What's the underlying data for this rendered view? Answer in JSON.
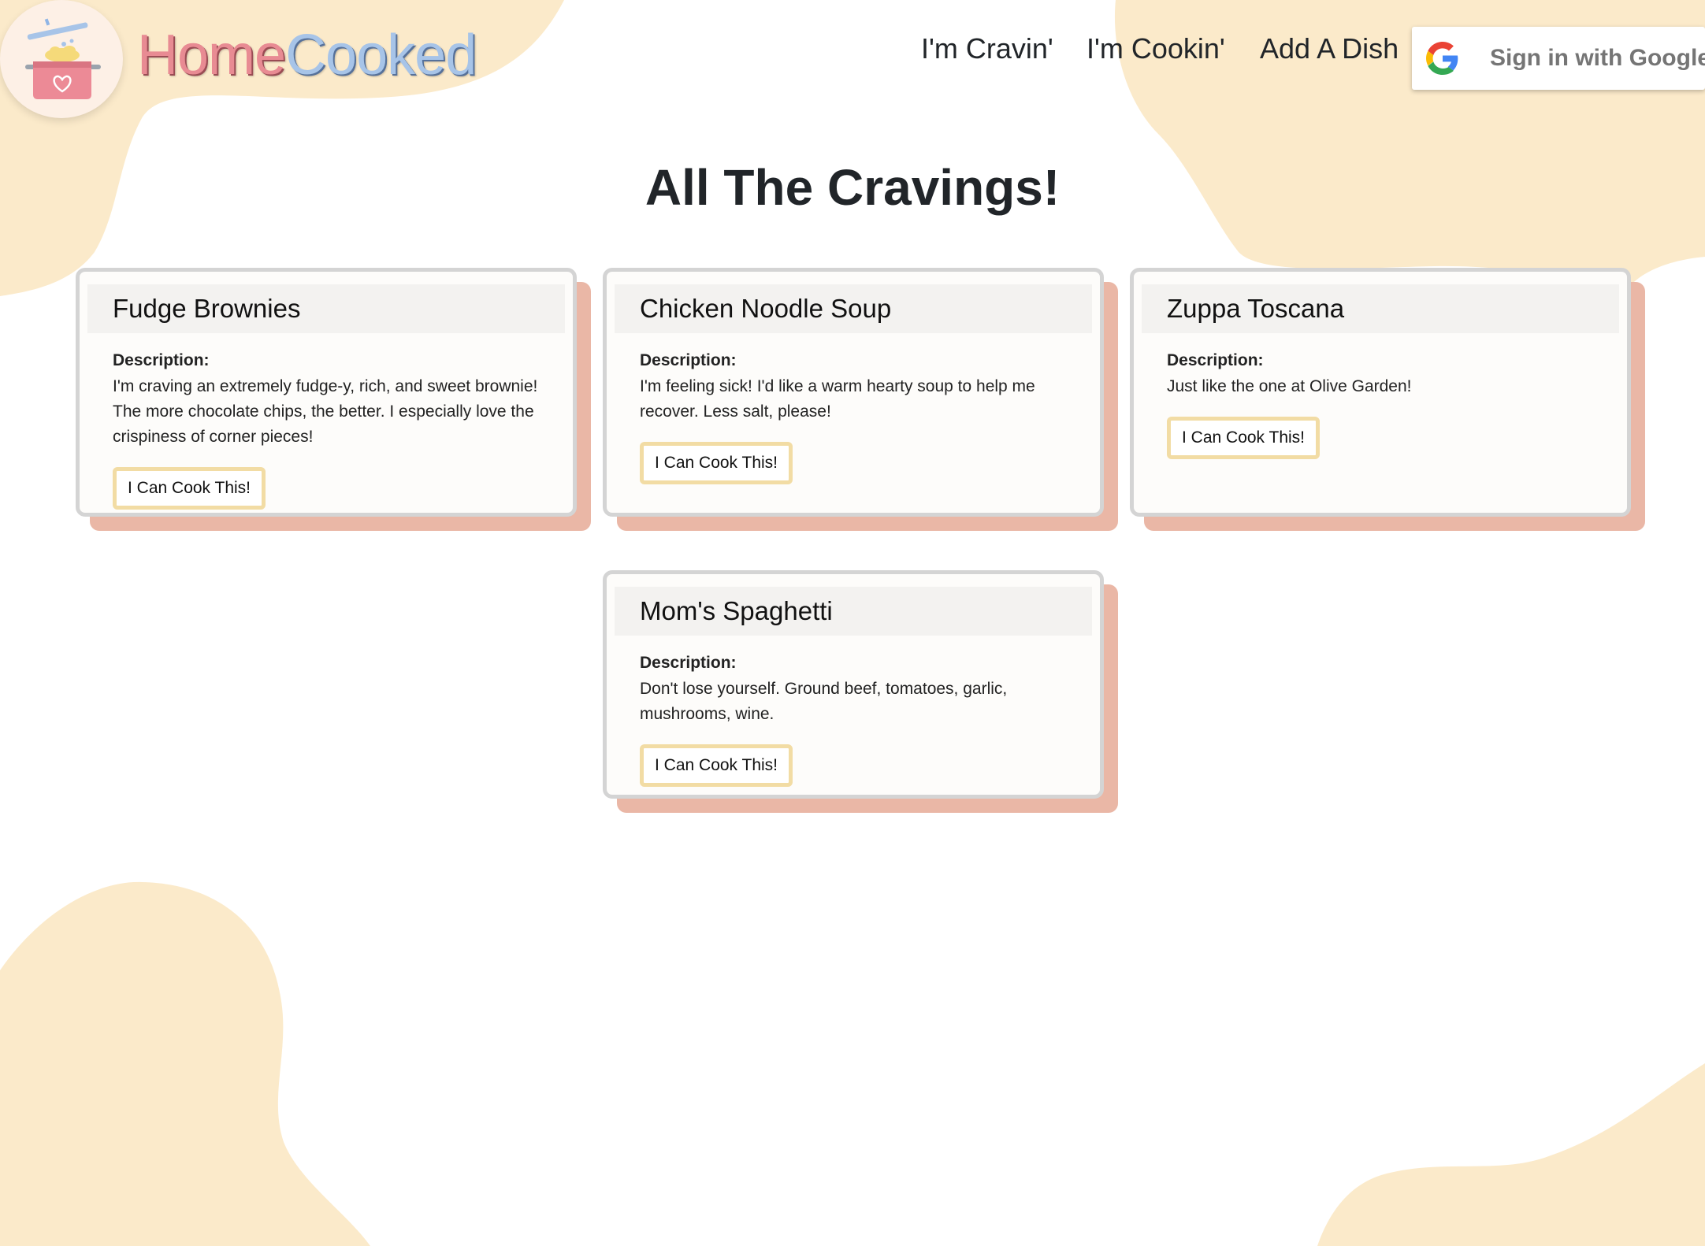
{
  "app": {
    "brand_home": "Home",
    "brand_cooked": "Cooked"
  },
  "nav": {
    "links": [
      {
        "label": "I'm Cravin'"
      },
      {
        "label": "I'm Cookin'"
      },
      {
        "label": "Add A Dish"
      }
    ],
    "google_signin_label": "Sign in with Google"
  },
  "main": {
    "title": "All The Cravings!",
    "cards": [
      {
        "title": "Fudge Brownies",
        "description_label": "Description:",
        "description": "I'm craving an extremely fudge-y, rich, and sweet brownie! The more chocolate chips, the better. I especially love the crispiness of corner pieces!",
        "button_label": "I Can Cook This!"
      },
      {
        "title": "Chicken Noodle Soup",
        "description_label": "Description:",
        "description": "I'm feeling sick! I'd like a warm hearty soup to help me recover. Less salt, please!",
        "button_label": "I Can Cook This!"
      },
      {
        "title": "Zuppa Toscana",
        "description_label": "Description:",
        "description": "Just like the one at Olive Garden!",
        "button_label": "I Can Cook This!"
      },
      {
        "title": "Mom's Spaghetti",
        "description_label": "Description:",
        "description": "Don't lose yourself. Ground beef, tomatoes, garlic, mushrooms, wine.",
        "button_label": "I Can Cook This!"
      }
    ]
  },
  "icons": {
    "logo": "cooking-pot-icon",
    "google": "google-g-icon"
  },
  "colors": {
    "blob": "#fbeaca",
    "brand_home": "#e88b93",
    "brand_cooked": "#a7c4e8",
    "card_shadow": "#eab7a6",
    "card_border": "#d4d4d4",
    "button_border": "#f2dca4"
  }
}
